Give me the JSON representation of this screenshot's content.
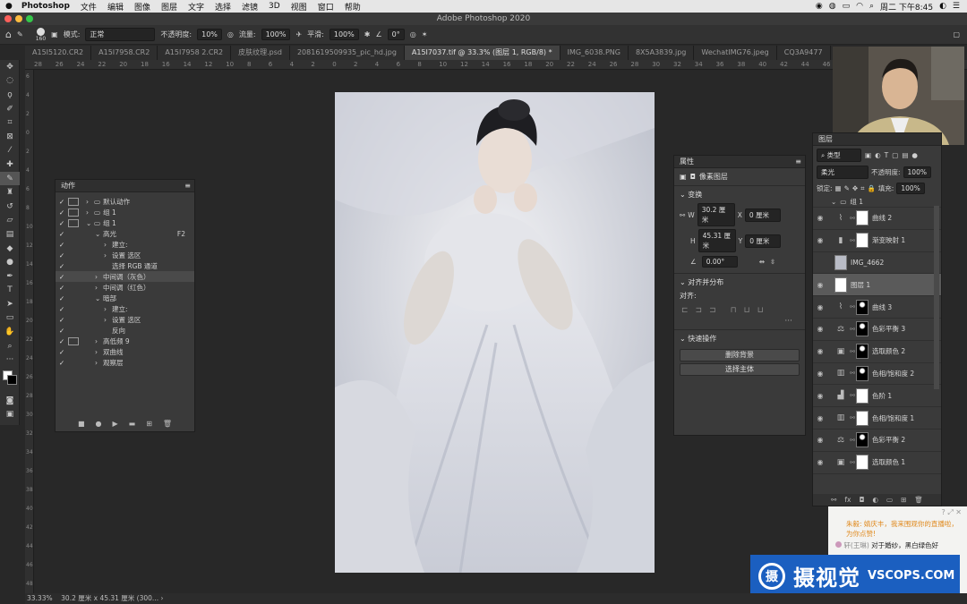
{
  "menubar": {
    "app": "Photoshop",
    "items": [
      "文件",
      "编辑",
      "图像",
      "图层",
      "文字",
      "选择",
      "滤镜",
      "3D",
      "视图",
      "窗口",
      "帮助"
    ],
    "clock": "周二 下午8:45"
  },
  "window": {
    "title": "Adobe Photoshop 2020"
  },
  "options": {
    "brush_size": "160",
    "mode_label": "模式:",
    "mode_value": "正常",
    "opacity_label": "不透明度:",
    "opacity_value": "10%",
    "flow_label": "流量:",
    "flow_value": "100%",
    "smooth_label": "平滑:",
    "smooth_value": "100%",
    "angle_value": "0°"
  },
  "tabs": [
    {
      "label": "A15I5120.CR2"
    },
    {
      "label": "A15I7958.CR2"
    },
    {
      "label": "A15I7958 2.CR2"
    },
    {
      "label": "皮肤纹理.psd"
    },
    {
      "label": "2081619509935_pic_hd.jpg"
    },
    {
      "label": "A15I7037.tif @ 33.3% (图层 1, RGB/8) *"
    },
    {
      "label": "IMG_6038.PNG"
    },
    {
      "label": "8X5A3839.jpg"
    },
    {
      "label": "WechatIMG76.jpeg"
    },
    {
      "label": "CQ3A9477"
    }
  ],
  "ruler_top": [
    "28",
    "26",
    "24",
    "22",
    "20",
    "18",
    "16",
    "14",
    "12",
    "10",
    "8",
    "6",
    "4",
    "2",
    "0",
    "2",
    "4",
    "6",
    "8",
    "10",
    "12",
    "14",
    "16",
    "18",
    "20",
    "22",
    "24",
    "26",
    "28",
    "30",
    "32",
    "34",
    "36",
    "38",
    "40",
    "42",
    "44",
    "46",
    "48",
    "50",
    "52",
    "54",
    "56",
    "58"
  ],
  "ruler_left": [
    "6",
    "4",
    "2",
    "0",
    "2",
    "4",
    "6",
    "8",
    "10",
    "12",
    "14",
    "16",
    "18",
    "20",
    "22",
    "24",
    "26",
    "28",
    "30",
    "32",
    "34",
    "36",
    "38",
    "40",
    "42",
    "44",
    "46",
    "48"
  ],
  "actions": {
    "title": "动作",
    "rows": [
      {
        "label": "默认动作",
        "indent": 0,
        "type": "folder",
        "check": true,
        "modal": true
      },
      {
        "label": "组 1",
        "indent": 0,
        "type": "folder",
        "check": true,
        "modal": true
      },
      {
        "label": "组 1",
        "indent": 0,
        "type": "folder-open",
        "check": true,
        "modal": true
      },
      {
        "label": "高光",
        "indent": 1,
        "type": "open",
        "check": true,
        "shortcut": "F2"
      },
      {
        "label": "建立:",
        "indent": 2,
        "type": "closed",
        "check": true
      },
      {
        "label": "设置 选区",
        "indent": 2,
        "type": "closed",
        "check": true
      },
      {
        "label": "选择 RGB 通道",
        "indent": 2,
        "type": "none",
        "check": true
      },
      {
        "label": "中间调（灰色）",
        "indent": 1,
        "type": "closed",
        "check": true,
        "selected": true
      },
      {
        "label": "中间调（红色）",
        "indent": 1,
        "type": "closed",
        "check": true
      },
      {
        "label": "暗部",
        "indent": 1,
        "type": "open",
        "check": true
      },
      {
        "label": "建立:",
        "indent": 2,
        "type": "closed",
        "check": true
      },
      {
        "label": "设置 选区",
        "indent": 2,
        "type": "closed",
        "check": true
      },
      {
        "label": "反向",
        "indent": 2,
        "type": "none",
        "check": true
      },
      {
        "label": "高低频 9",
        "indent": 1,
        "type": "closed",
        "check": true,
        "modal": true
      },
      {
        "label": "双曲线",
        "indent": 1,
        "type": "closed",
        "check": true
      },
      {
        "label": "观察层",
        "indent": 1,
        "type": "closed",
        "check": true
      }
    ]
  },
  "properties": {
    "title": "属性",
    "subtitle": "像素图层",
    "transform_label": "变换",
    "w_label": "W",
    "w_value": "30.2 厘米",
    "h_label": "H",
    "h_value": "45.31 厘米",
    "x_label": "X",
    "x_value": "0 厘米",
    "y_label": "Y",
    "y_value": "0 厘米",
    "angle_value": "0.00°",
    "align_label": "对齐并分布",
    "align_sub": "对齐:",
    "quick_label": "快速操作",
    "btn_remove_bg": "删除背景",
    "btn_select_subject": "选择主体"
  },
  "layers": {
    "title": "图层",
    "filter_kind": "类型",
    "blend_mode": "柔光",
    "opacity_label": "不透明度:",
    "opacity_value": "100%",
    "lock_label": "锁定:",
    "fill_label": "填充:",
    "fill_value": "100%",
    "group_name": "组 1",
    "rows": [
      {
        "name": "曲线 2",
        "icon": "curves-icon",
        "mask": "white",
        "visible": true
      },
      {
        "name": "渐变映射 1",
        "icon": "gradient-map-icon",
        "mask": "white",
        "visible": true
      },
      {
        "name": "IMG_4662",
        "icon": "",
        "mask": "photo",
        "visible": false
      },
      {
        "name": "图层 1",
        "icon": "",
        "mask": "white",
        "visible": true,
        "selected": true
      },
      {
        "name": "曲线 3",
        "icon": "curves-icon",
        "mask": "dark",
        "visible": true
      },
      {
        "name": "色彩平衡 3",
        "icon": "color-balance-icon",
        "mask": "dark",
        "visible": true
      },
      {
        "name": "选取颜色 2",
        "icon": "selective-color-icon",
        "mask": "dark",
        "visible": true
      },
      {
        "name": "色相/饱和度 2",
        "icon": "hue-sat-icon",
        "mask": "dark",
        "visible": true
      },
      {
        "name": "色阶 1",
        "icon": "levels-icon",
        "mask": "white",
        "visible": true
      },
      {
        "name": "色相/饱和度 1",
        "icon": "hue-sat-icon",
        "mask": "white",
        "visible": true
      },
      {
        "name": "色彩平衡 2",
        "icon": "color-balance-icon",
        "mask": "dark",
        "visible": true
      },
      {
        "name": "选取颜色 1",
        "icon": "selective-color-icon",
        "mask": "white",
        "visible": true
      }
    ]
  },
  "chat": {
    "line1": "朱毅: 婧庆丰，我来围观你的直播啦，为你点赞!",
    "line2_user": "轩(王琳)",
    "line2_text": "对于婚纱，黑白绿色好"
  },
  "banner": {
    "cn": "摄视觉",
    "url": "VSCOPS.COM"
  },
  "status": {
    "zoom": "33.33%",
    "doc": "30.2 厘米 x 45.31 厘米 (300..."
  },
  "colors": {
    "accent": "#1b5fc0",
    "panel": "#3a3a3a"
  }
}
